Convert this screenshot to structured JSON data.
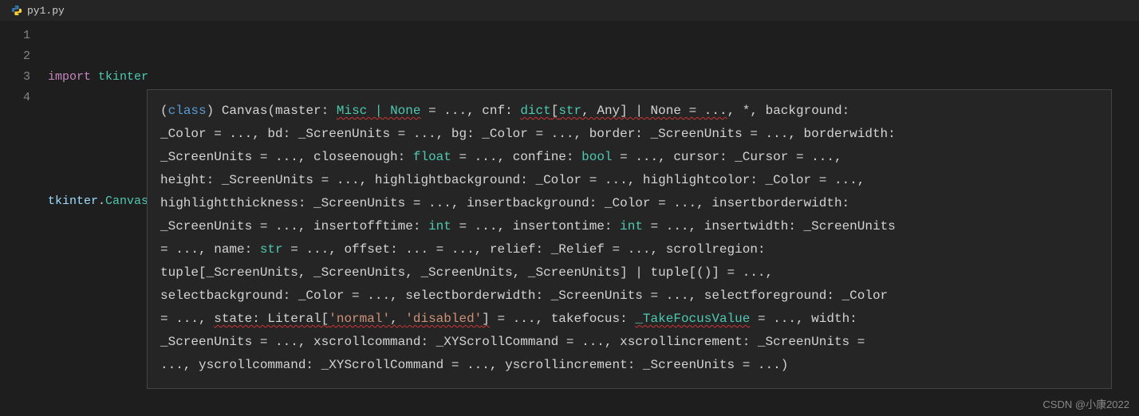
{
  "tab": {
    "filename": "py1.py"
  },
  "gutter": {
    "l1": "1",
    "l2": "2",
    "l3": "3",
    "l4": "4"
  },
  "code": {
    "import_kw": "import",
    "module": "tkinter",
    "call_mod": "tkinter",
    "dot": ".",
    "call_fn": "Canvas",
    "lparen": "(",
    "rparen": ")"
  },
  "tooltip": {
    "t01": "(",
    "t02": "class",
    "t03": ") Canvas(master: ",
    "t04": "Misc | None",
    "t04b": " = ..., cnf: ",
    "t05": "dict",
    "t06": "[",
    "t07": "str",
    "t08": ", Any] | None = ...",
    "t09": ", *, background: ",
    "t10": "_Color = ..., bd: _ScreenUnits = ..., bg: _Color = ..., border: _ScreenUnits = ..., borderwidth: ",
    "t11": "_ScreenUnits = ..., closeenough: ",
    "t12": "float",
    "t13": " = ..., confine: ",
    "t14": "bool",
    "t15": " = ..., cursor: _Cursor = ..., ",
    "t16": "height: _ScreenUnits = ..., highlightbackground: _Color = ..., highlightcolor: _Color = ..., ",
    "t17": "highlightthickness: _ScreenUnits = ..., insertbackground: _Color = ..., insertborderwidth: ",
    "t18": "_ScreenUnits = ..., insertofftime: ",
    "t19": "int",
    "t20": " = ..., insertontime: ",
    "t21": "int",
    "t22": " = ..., insertwidth: _ScreenUnits ",
    "t23": "= ..., name: ",
    "t24": "str",
    "t25": " = ..., offset: ... = ..., relief: _Relief = ..., scrollregion: ",
    "t26": "tuple[_ScreenUnits, _ScreenUnits, _ScreenUnits, _ScreenUnits] | tuple[()] = ..., ",
    "t27": "selectbackground: _Color = ..., selectborderwidth: _ScreenUnits = ..., selectforeground: _Color ",
    "t28": "= ..., ",
    "t28b": "state: Literal[",
    "t29": "'normal'",
    "t30": ", ",
    "t31": "'disabled'",
    "t32": "]",
    "t32b": " = ..., takefocus: ",
    "t33": "_TakeFocusValue",
    "t33b": " = ..., width: ",
    "t34": "_ScreenUnits = ..., xscrollcommand: _XYScrollCommand = ..., xscrollincrement: _ScreenUnits = ",
    "t35": "..., yscrollcommand: _XYScrollCommand = ..., yscrollincrement: _ScreenUnits = ...)"
  },
  "watermark": "CSDN @小康2022"
}
